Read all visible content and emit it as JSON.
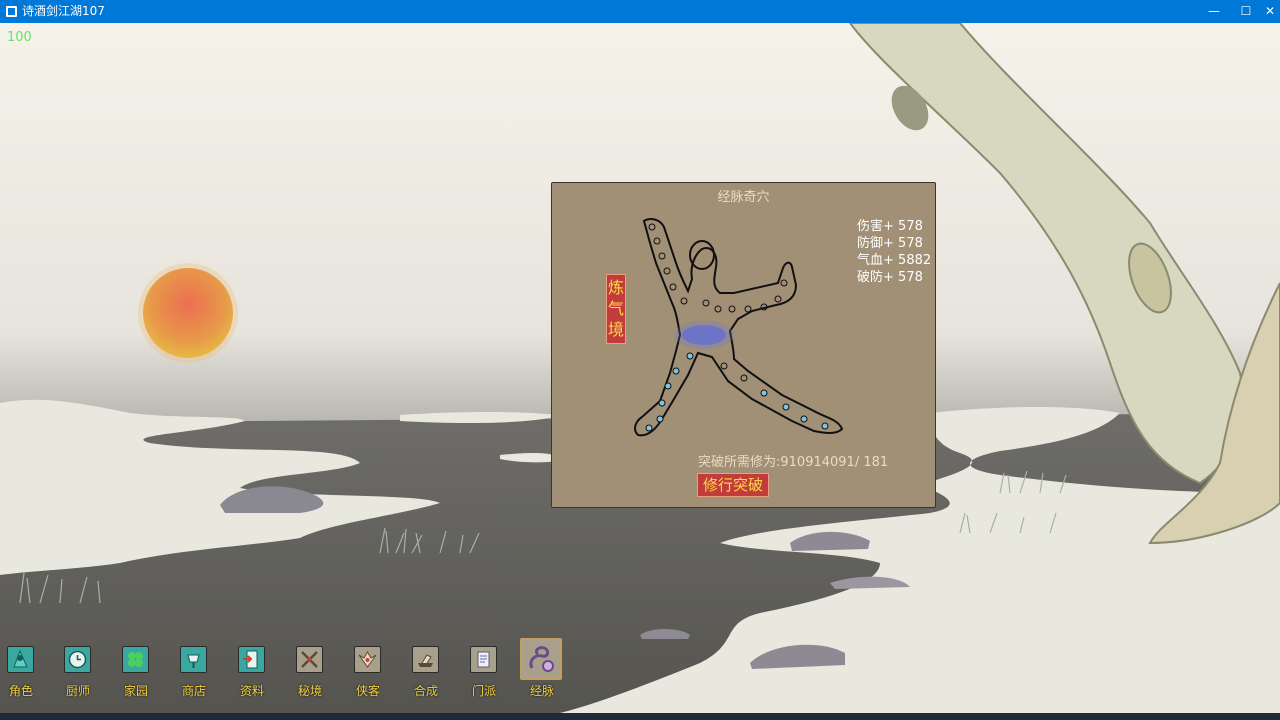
{
  "window": {
    "title": "诗酒剑江湖107",
    "minimize_glyph": "—",
    "maximize_glyph": "☐",
    "close_glyph": "✕"
  },
  "hud": {
    "fps": "100"
  },
  "dialog": {
    "title": "经脉奇穴",
    "realm": "炼气境",
    "stats": [
      {
        "label": "伤害+",
        "value": "578"
      },
      {
        "label": "防御+",
        "value": "578"
      },
      {
        "label": "气血+",
        "value": "5882"
      },
      {
        "label": "破防+",
        "value": "578"
      }
    ],
    "requirement_text": "突破所需修为:910914091/  181",
    "breakthrough_button": "修行突破"
  },
  "toolbar": [
    {
      "label": "角色",
      "icon": "character-icon"
    },
    {
      "label": "厨师",
      "icon": "clock-icon"
    },
    {
      "label": "家园",
      "icon": "clover-icon"
    },
    {
      "label": "商店",
      "icon": "shop-icon"
    },
    {
      "label": "资料",
      "icon": "door-icon"
    },
    {
      "label": "秘境",
      "icon": "crossed-swords-icon"
    },
    {
      "label": "侠客",
      "icon": "hero-emblem-icon"
    },
    {
      "label": "合成",
      "icon": "forge-icon"
    },
    {
      "label": "门派",
      "icon": "scroll-icon"
    },
    {
      "label": "经脉",
      "icon": "meridian-icon"
    }
  ],
  "colors": {
    "titlebar": "#0078d7",
    "dialog_bg": "#a18f76",
    "badge_red": "#c23c3c",
    "label_gold": "#f0d040",
    "fps_green": "#6ee06e"
  }
}
